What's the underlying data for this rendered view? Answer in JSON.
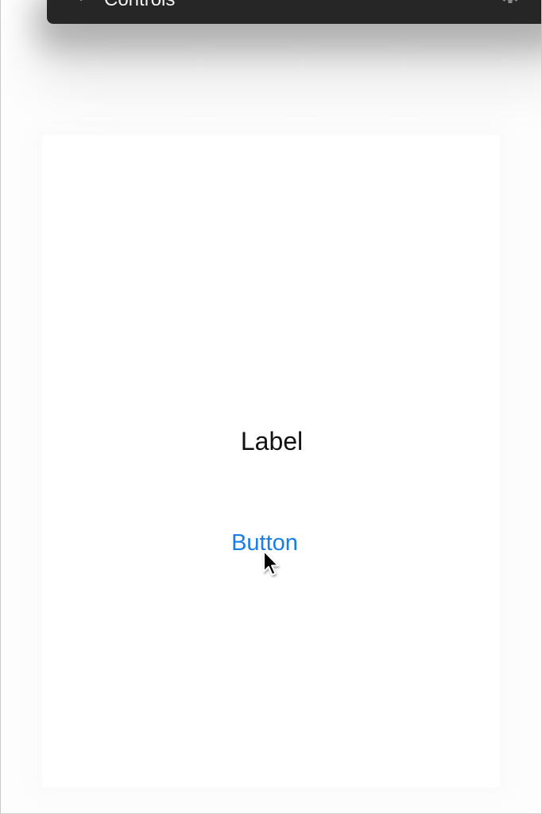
{
  "toolbar": {
    "title": "Controls",
    "collapse_icon": "chevron-down-icon",
    "settings_icon": "gear-icon",
    "background_color": "#262626"
  },
  "main": {
    "label_text": "Label",
    "button_label": "Button",
    "button_color": "#1a7ee6"
  },
  "pointer": {
    "icon": "mouse-pointer-icon"
  }
}
